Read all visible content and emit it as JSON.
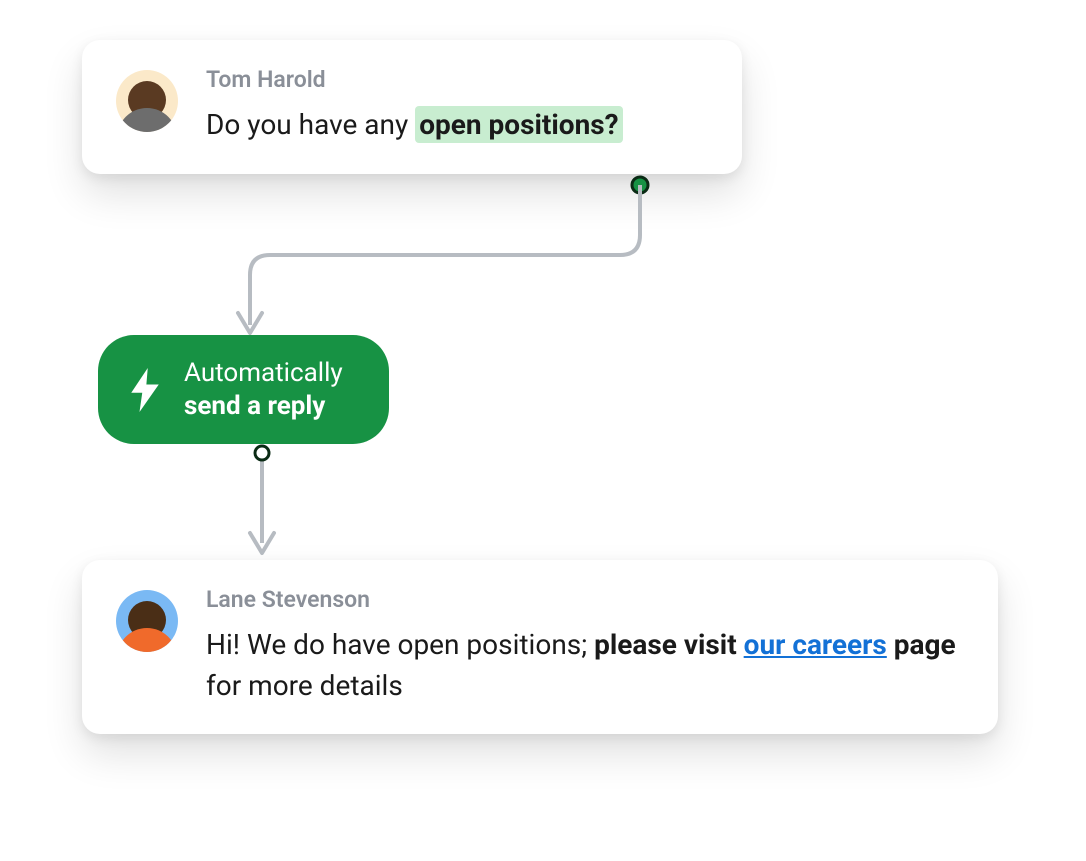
{
  "card1": {
    "author": "Tom Harold",
    "msg_prefix": "Do you have any ",
    "msg_highlight": "open positions?"
  },
  "pill": {
    "line1": "Automatically",
    "line2": "send a reply"
  },
  "card2": {
    "author": "Lane Stevenson",
    "msg_prefix": "Hi! We do have open positions; ",
    "msg_bold1": "please visit ",
    "msg_link": "our careers",
    "msg_bold2": " page",
    "msg_suffix": " for more details"
  },
  "colors": {
    "accent": "#179244",
    "highlight": "#c8edd0",
    "link": "#1371d6"
  }
}
